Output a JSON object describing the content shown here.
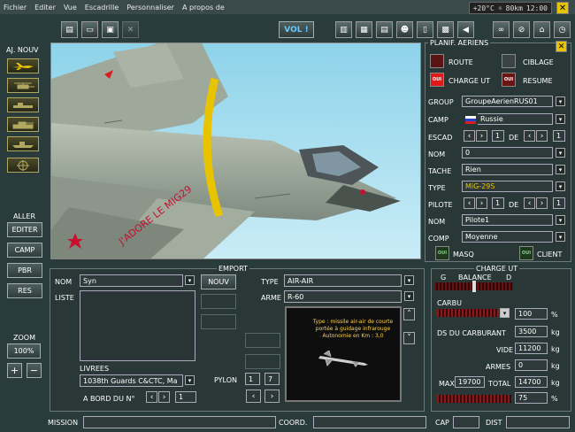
{
  "menu": [
    "Fichier",
    "Editer",
    "Vue",
    "Escadrille",
    "Personnaliser",
    "A propos de"
  ],
  "status": {
    "temp": "+20°C",
    "wind": "80km",
    "time": "12:00"
  },
  "toolbar": {
    "vol_label": "VOL !"
  },
  "left": {
    "aj_nouv": "AJ. NOUV",
    "aller": "ALLER",
    "editer": "EDITER",
    "camp": "CAMP",
    "pbr": "PBR",
    "res": "RES",
    "zoom": "ZOOM",
    "zoom_value": "100%",
    "plus": "+",
    "minus": "−"
  },
  "view": {
    "aircraft_text": "J'ADORE LE MIG29"
  },
  "planif": {
    "title": "PLANIF. AERIENS",
    "route": "ROUTE",
    "ciblage": "CIBLAGE",
    "charge_ut": "CHARGE UT",
    "resume": "RESUME",
    "oui": "OUI",
    "group_label": "GROUP",
    "group_value": "GroupeAerienRUS01",
    "camp_label": "CAMP",
    "camp_value": "Russie",
    "escad_label": "ESCAD",
    "escad_value": "1",
    "de_label": "DE",
    "escad_de_value": "1",
    "nom_label": "NOM",
    "nom_value": "0",
    "tache_label": "TACHE",
    "tache_value": "Rien",
    "type_label": "TYPE",
    "type_value": "MiG-29S",
    "pilote_label": "PILOTE",
    "pilote_value": "1",
    "pilote_de_value": "1",
    "nom2_label": "NOM",
    "nom2_value": "Pilote1",
    "comp_label": "COMP",
    "comp_value": "Moyenne",
    "masq": "MASQ",
    "client": "CLIENT"
  },
  "emport": {
    "title": "EMPORT",
    "nom_label": "NOM",
    "nom_value": "Syn",
    "nouv": "NOUV",
    "liste_label": "LISTE",
    "type_label": "TYPE",
    "type_value": "AIR-AIR",
    "arme_label": "ARME",
    "arme_value": "R-60",
    "desc": "Type : missile air-air de courte portée à guidage infrarouge Autonomie en Km : 3,0",
    "livrees_label": "LIVREES",
    "livrees_value": "1038th Guards C&CTC, Ma",
    "pylon_label": "PYLON",
    "pylon_a": "1",
    "pylon_b": "7",
    "abord_label": "A BORD DU N°",
    "abord_value": "1"
  },
  "charge": {
    "title": "CHARGE UT",
    "g": "G",
    "balance": "BALANCE",
    "d": "D",
    "carbu_label": "CARBU",
    "carbu_value": "100",
    "pct": "%",
    "ds_label": "DS DU CARBURANT",
    "ds_value": "3500",
    "kg": "kg",
    "vide_label": "VIDE",
    "vide_value": "11200",
    "armes_label": "ARMES",
    "armes_value": "0",
    "max_label": "MAX",
    "max_value": "19700",
    "total_label": "TOTAL",
    "total_value": "14700",
    "last_value": "75"
  },
  "bottom": {
    "mission": "MISSION",
    "coord": "COORD.",
    "cap": "CAP",
    "dist": "DIST"
  }
}
